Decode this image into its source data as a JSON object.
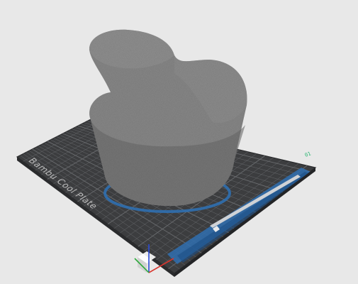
{
  "scene": {
    "plate_name": "Bambu Cool Plate",
    "plate_number": "01",
    "colors": {
      "background": "#e8e8e8",
      "plate": "#3c3d3f",
      "plate_edge": "#2a2b2d",
      "grid": "#6b6d70",
      "object": "#8b8b8b",
      "object_shadow": "#6c6c6c",
      "brim": "#2f6fb0",
      "axis_x": "#d8332c",
      "axis_y": "#2eaa3c",
      "axis_z": "#2b4bd8",
      "plate_number": "#2bb673"
    }
  }
}
